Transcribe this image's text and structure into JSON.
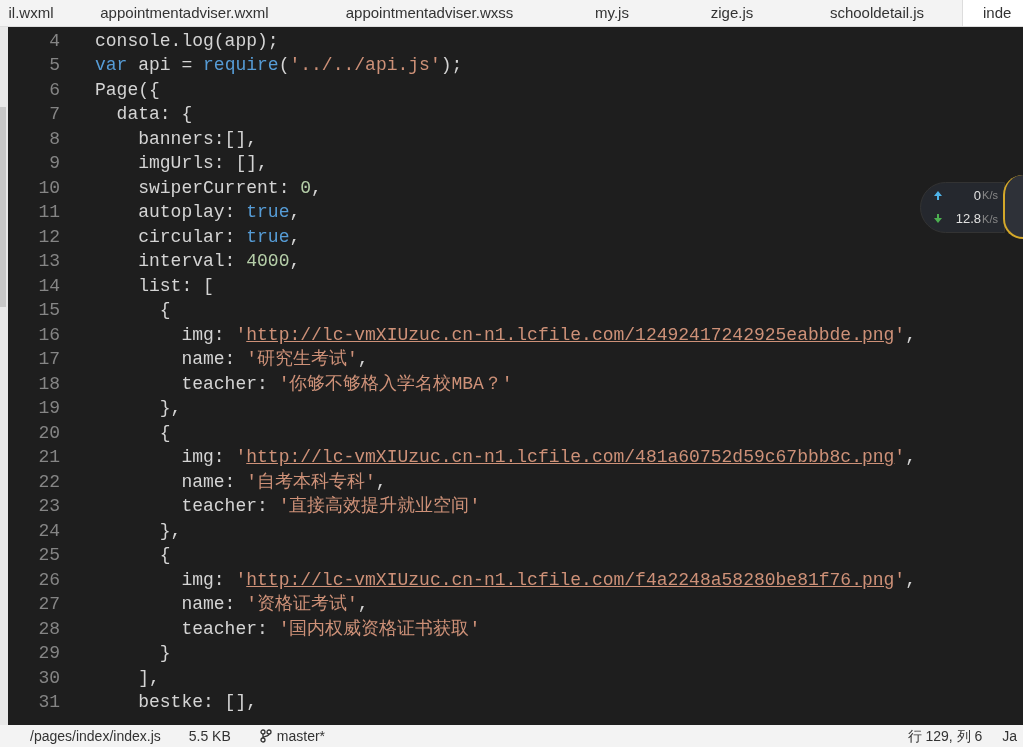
{
  "tabs": [
    {
      "label": "il.wxml",
      "selected": false
    },
    {
      "label": "appointmentadviser.wxml",
      "selected": false
    },
    {
      "label": "appointmentadviser.wxss",
      "selected": false
    },
    {
      "label": "my.js",
      "selected": false
    },
    {
      "label": "zige.js",
      "selected": false
    },
    {
      "label": "schooldetail.js",
      "selected": false
    },
    {
      "label": "inde",
      "selected": true
    }
  ],
  "code_lines": [
    {
      "number": "4",
      "tokens": [
        {
          "kind": "plain",
          "text": "console.log(app);"
        }
      ]
    },
    {
      "number": "5",
      "tokens": [
        {
          "kind": "keyword",
          "text": "var"
        },
        {
          "kind": "plain",
          "text": " api = "
        },
        {
          "kind": "keyword",
          "text": "require"
        },
        {
          "kind": "plain",
          "text": "("
        },
        {
          "kind": "string",
          "text": "'../../api.js'"
        },
        {
          "kind": "plain",
          "text": ");"
        }
      ]
    },
    {
      "number": "6",
      "tokens": [
        {
          "kind": "plain",
          "text": "Page({"
        }
      ]
    },
    {
      "number": "7",
      "tokens": [
        {
          "kind": "plain",
          "text": "  data: {"
        }
      ]
    },
    {
      "number": "8",
      "tokens": [
        {
          "kind": "plain",
          "text": "    banners:[],"
        }
      ]
    },
    {
      "number": "9",
      "tokens": [
        {
          "kind": "plain",
          "text": "    imgUrls: [],"
        }
      ]
    },
    {
      "number": "10",
      "tokens": [
        {
          "kind": "plain",
          "text": "    swiperCurrent: "
        },
        {
          "kind": "number",
          "text": "0"
        },
        {
          "kind": "plain",
          "text": ","
        }
      ]
    },
    {
      "number": "11",
      "tokens": [
        {
          "kind": "plain",
          "text": "    autoplay: "
        },
        {
          "kind": "keyword",
          "text": "true"
        },
        {
          "kind": "plain",
          "text": ","
        }
      ]
    },
    {
      "number": "12",
      "tokens": [
        {
          "kind": "plain",
          "text": "    circular: "
        },
        {
          "kind": "keyword",
          "text": "true"
        },
        {
          "kind": "plain",
          "text": ","
        }
      ]
    },
    {
      "number": "13",
      "tokens": [
        {
          "kind": "plain",
          "text": "    interval: "
        },
        {
          "kind": "number",
          "text": "4000"
        },
        {
          "kind": "plain",
          "text": ","
        }
      ]
    },
    {
      "number": "14",
      "tokens": [
        {
          "kind": "plain",
          "text": "    list: ["
        }
      ]
    },
    {
      "number": "15",
      "tokens": [
        {
          "kind": "plain",
          "text": "      {"
        }
      ]
    },
    {
      "number": "16",
      "tokens": [
        {
          "kind": "plain",
          "text": "        img: "
        },
        {
          "kind": "string",
          "text": "'"
        },
        {
          "kind": "link",
          "text": "http://lc-vmXIUzuc.cn-n1.lcfile.com/12492417242925eabbde.png"
        },
        {
          "kind": "string",
          "text": "'"
        },
        {
          "kind": "plain",
          "text": ","
        }
      ]
    },
    {
      "number": "17",
      "tokens": [
        {
          "kind": "plain",
          "text": "        name: "
        },
        {
          "kind": "string",
          "text": "'研究生考试'"
        },
        {
          "kind": "plain",
          "text": ","
        }
      ]
    },
    {
      "number": "18",
      "tokens": [
        {
          "kind": "plain",
          "text": "        teacher: "
        },
        {
          "kind": "string",
          "text": "'你够不够格入学名校MBA？'"
        }
      ]
    },
    {
      "number": "19",
      "tokens": [
        {
          "kind": "plain",
          "text": "      },"
        }
      ]
    },
    {
      "number": "20",
      "tokens": [
        {
          "kind": "plain",
          "text": "      {"
        }
      ]
    },
    {
      "number": "21",
      "tokens": [
        {
          "kind": "plain",
          "text": "        img: "
        },
        {
          "kind": "string",
          "text": "'"
        },
        {
          "kind": "link",
          "text": "http://lc-vmXIUzuc.cn-n1.lcfile.com/481a60752d59c67bbb8c.png"
        },
        {
          "kind": "string",
          "text": "'"
        },
        {
          "kind": "plain",
          "text": ","
        }
      ]
    },
    {
      "number": "22",
      "tokens": [
        {
          "kind": "plain",
          "text": "        name: "
        },
        {
          "kind": "string",
          "text": "'自考本科专科'"
        },
        {
          "kind": "plain",
          "text": ","
        }
      ]
    },
    {
      "number": "23",
      "tokens": [
        {
          "kind": "plain",
          "text": "        teacher: "
        },
        {
          "kind": "string",
          "text": "'直接高效提升就业空间'"
        }
      ]
    },
    {
      "number": "24",
      "tokens": [
        {
          "kind": "plain",
          "text": "      },"
        }
      ]
    },
    {
      "number": "25",
      "tokens": [
        {
          "kind": "plain",
          "text": "      {"
        }
      ]
    },
    {
      "number": "26",
      "tokens": [
        {
          "kind": "plain",
          "text": "        img: "
        },
        {
          "kind": "string",
          "text": "'"
        },
        {
          "kind": "link",
          "text": "http://lc-vmXIUzuc.cn-n1.lcfile.com/f4a2248a58280be81f76.png"
        },
        {
          "kind": "string",
          "text": "'"
        },
        {
          "kind": "plain",
          "text": ","
        }
      ]
    },
    {
      "number": "27",
      "tokens": [
        {
          "kind": "plain",
          "text": "        name: "
        },
        {
          "kind": "string",
          "text": "'资格证考试'"
        },
        {
          "kind": "plain",
          "text": ","
        }
      ]
    },
    {
      "number": "28",
      "tokens": [
        {
          "kind": "plain",
          "text": "        teacher: "
        },
        {
          "kind": "string",
          "text": "'国内权威资格证书获取'"
        }
      ]
    },
    {
      "number": "29",
      "tokens": [
        {
          "kind": "plain",
          "text": "      }"
        }
      ]
    },
    {
      "number": "30",
      "tokens": [
        {
          "kind": "plain",
          "text": "    ],"
        }
      ]
    },
    {
      "number": "31",
      "tokens": [
        {
          "kind": "plain",
          "text": "    bestke: [],"
        }
      ]
    }
  ],
  "net_speed": {
    "upload": {
      "value": "0",
      "unit": "K/s"
    },
    "download": {
      "value": "12.8",
      "unit": "K/s"
    }
  },
  "status_bar": {
    "path": "/pages/index/index.js",
    "size": "5.5 KB",
    "branch": "master*",
    "position": "行 129, 列 6",
    "language": "Ja"
  }
}
